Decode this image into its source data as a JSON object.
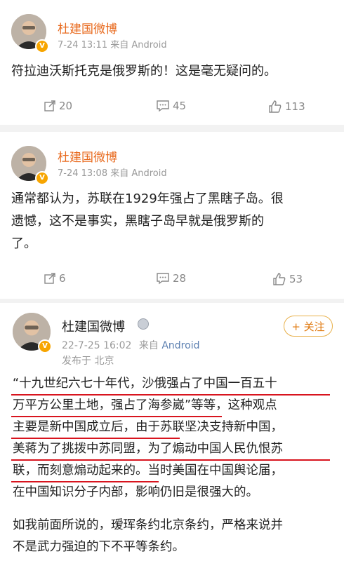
{
  "posts": [
    {
      "username": "杜建国微博",
      "meta": "7-24 13:11 来自 Android",
      "text": "符拉迪沃斯托克是俄罗斯的！这是毫无疑问的。",
      "reposts": "20",
      "comments": "45",
      "likes": "113"
    },
    {
      "username": "杜建国微博",
      "meta": "7-24 13:08 来自 Android",
      "text_lines": [
        "通常都认为，苏联在1929年强占了黑瞎子岛。很",
        "遗憾，这不是事实，黑瞎子岛早就是俄罗斯的",
        "了。"
      ],
      "reposts": "6",
      "comments": "28",
      "likes": "53"
    },
    {
      "username": "杜建国微博",
      "date": "22-7-25 16:02",
      "source_prefix": "来自",
      "source": "Android",
      "location": "发布于 北京",
      "follow_label": "+ 关注",
      "lines": [
        "“十九世纪六七十年代，沙俄强占了中国一百五十",
        "万平方公里土地，强占了海参崴”等等，这种观点",
        "主要是新中国成立后，由于苏联坚决支持新中国，",
        "美蒋为了挑拨中苏同盟，为了煽动中国人民仇恨苏",
        "联，而刻意煽动起来的。当时美国在中国舆论届，",
        "在中国知识分子内部，影响仍旧是很强大的。"
      ],
      "para2_lines": [
        "如我前面所说的，瑷珲条约北京条约，严格来说并",
        "不是武力强迫的下不平等条约。"
      ]
    }
  ],
  "colors": {
    "username": "#e86a1e",
    "underline": "#d8141e",
    "follow_border": "#e8b04a"
  },
  "icons": [
    "repost-icon",
    "comment-icon",
    "like-icon",
    "verified-badge-icon",
    "vip-medal-icon"
  ]
}
